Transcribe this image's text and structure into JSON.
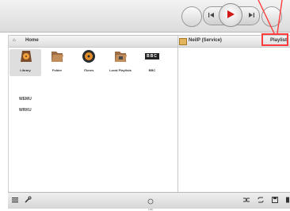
{
  "header": {
    "home_label": "Home",
    "service_label": "NeilP (Service)",
    "playlist_label": "Playlist"
  },
  "browse": {
    "tiles": [
      {
        "label": "Library",
        "icon": "library-icon"
      },
      {
        "label": "Folder",
        "icon": "folder-icon"
      },
      {
        "label": "iTunes",
        "icon": "itunes-icon"
      },
      {
        "label": "Local Playlists",
        "icon": "local-playlists-icon"
      },
      {
        "label": "BBC",
        "icon": "bbc-icon"
      }
    ],
    "list": [
      "WEMU",
      "WRKU"
    ]
  },
  "bbc_logo_text": "BBC",
  "bottom": {
    "center_label": "Link"
  },
  "colors": {
    "annotation": "#ff3b3b",
    "tile_selected_bg": "#dedede"
  }
}
